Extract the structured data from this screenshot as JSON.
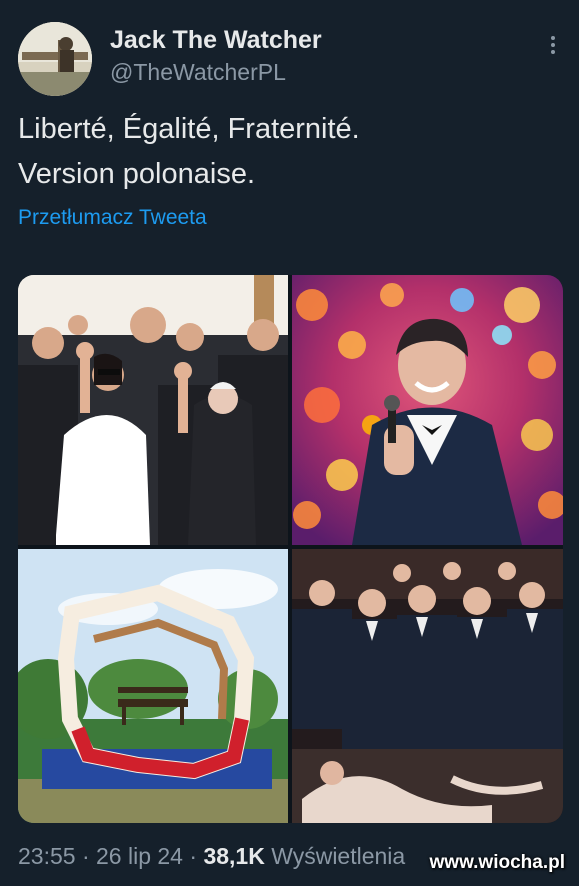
{
  "author": {
    "display_name": "Jack The Watcher",
    "handle": "@TheWatcherPL"
  },
  "tweet": {
    "text_line1": "Liberté, Égalité, Fraternité.",
    "text_line2": "Version polonaise.",
    "translate_label": "Przetłumacz Tweeta"
  },
  "media": {
    "photos": [
      "group-raised-hands-photo",
      "singer-with-microphone-photo",
      "poland-map-bench-sculpture-photo",
      "audience-front-row-photo"
    ]
  },
  "meta": {
    "time": "23:55",
    "separator": " · ",
    "date": "26 lip 24",
    "views_count": "38,1K",
    "views_label": " Wyświetlenia"
  },
  "watermark": "www.wiocha.pl",
  "colors": {
    "background": "#15202b",
    "link": "#1d9bf0",
    "secondary_text": "#8b98a5",
    "primary_text": "#e7e9ea"
  }
}
